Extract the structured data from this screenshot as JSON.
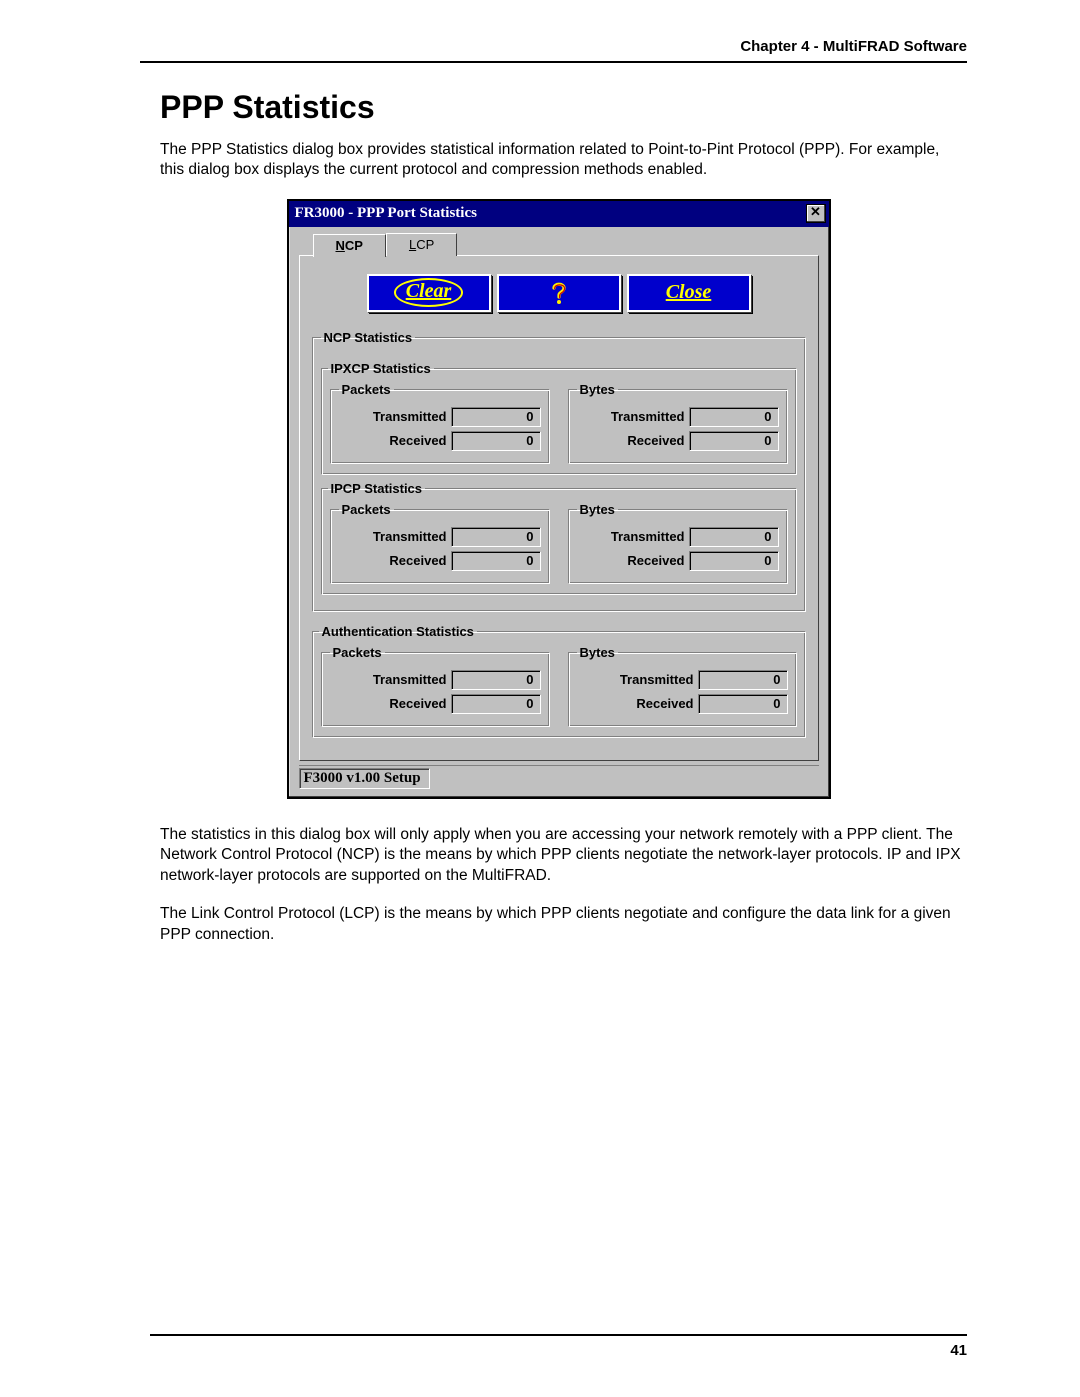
{
  "doc": {
    "chapter_header": "Chapter 4 - MultiFRAD Software",
    "section_title": "PPP Statistics",
    "intro_p1": "The PPP Statistics dialog box provides statistical information related to Point-to-Pint Protocol (PPP). For example, this dialog box displays the current protocol and compression methods enabled.",
    "after_p1": "The statistics in this dialog box will only apply when you are accessing your network remotely with a PPP client.  The Network Control Protocol (NCP) is the means by which PPP clients negotiate the network-layer protocols.  IP and IPX network-layer protocols are supported on the MultiFRAD.",
    "after_p2": "The Link Control Protocol (LCP) is the means by which PPP clients negotiate and configure the data link for a given PPP connection.",
    "page_number": "41"
  },
  "dialog": {
    "title": "FR3000 - PPP Port Statistics",
    "tabs": {
      "ncp": "NCP",
      "lcp": "LCP"
    },
    "buttons": {
      "clear": "Clear",
      "close": "Close"
    },
    "labels": {
      "ncp_stats": "NCP Statistics",
      "ipxcp": "IPXCP Statistics",
      "ipcp": "IPCP Statistics",
      "auth": "Authentication Statistics",
      "packets": "Packets",
      "bytes": "Bytes",
      "transmitted": "Transmitted",
      "received": "Received"
    },
    "values": {
      "ipxcp": {
        "pkt_tx": "0",
        "pkt_rx": "0",
        "byte_tx": "0",
        "byte_rx": "0"
      },
      "ipcp": {
        "pkt_tx": "0",
        "pkt_rx": "0",
        "byte_tx": "0",
        "byte_rx": "0"
      },
      "auth": {
        "pkt_tx": "0",
        "pkt_rx": "0",
        "byte_tx": "0",
        "byte_rx": "0"
      }
    },
    "status": "F3000 v1.00 Setup"
  }
}
